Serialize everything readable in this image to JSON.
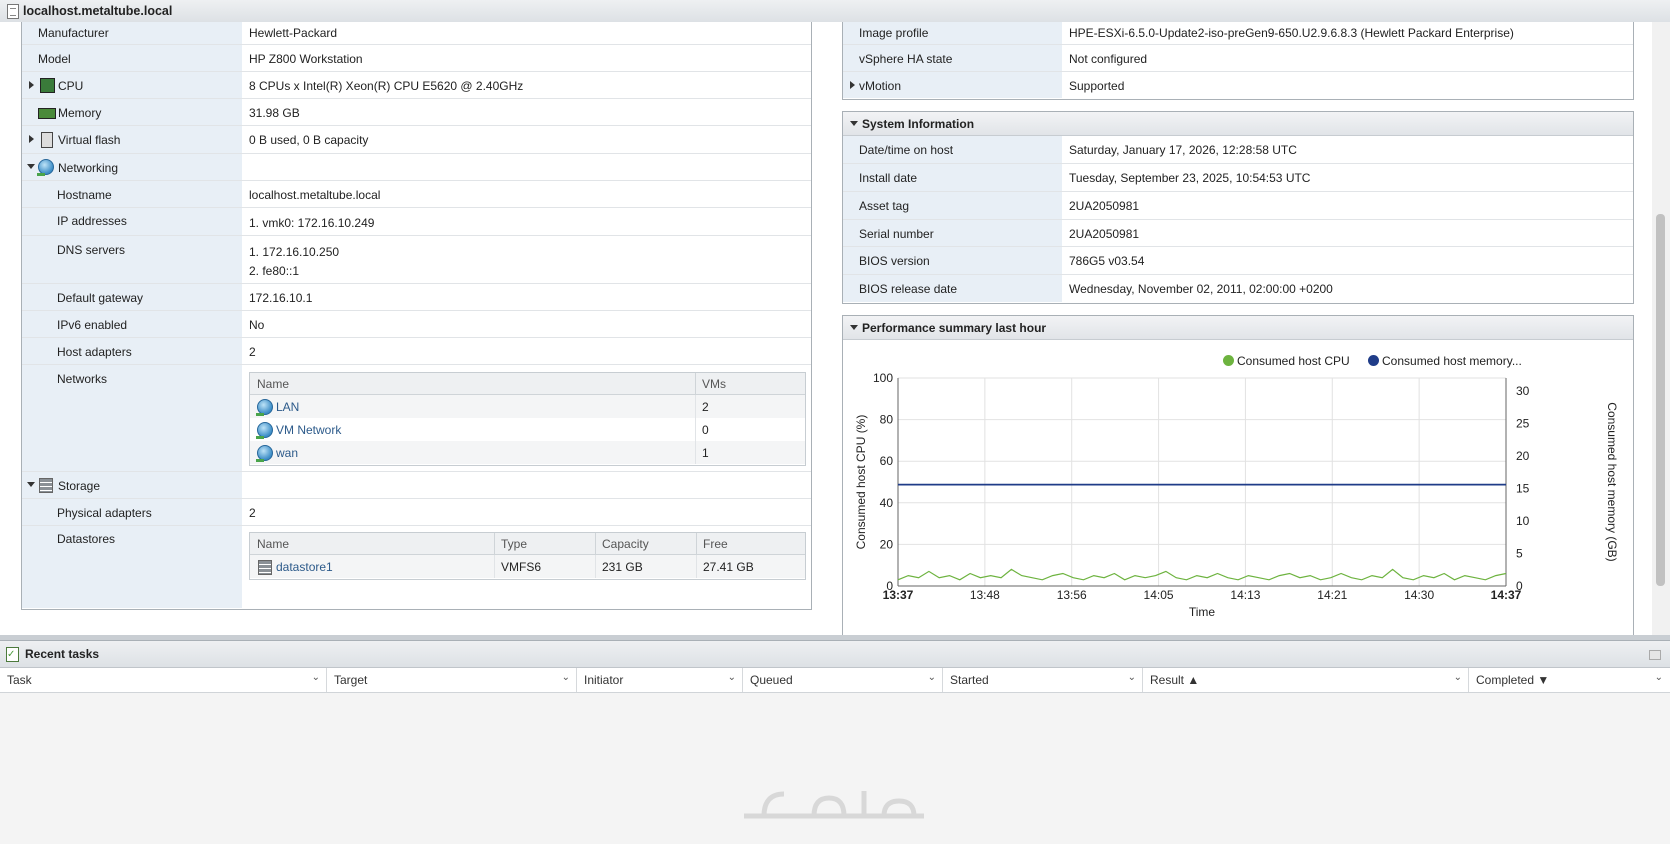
{
  "window": {
    "title": "localhost.metaltube.local"
  },
  "hardware": {
    "manufacturer": {
      "label": "Manufacturer",
      "value": "Hewlett-Packard"
    },
    "model": {
      "label": "Model",
      "value": "HP Z800 Workstation"
    },
    "cpu": {
      "label": "CPU",
      "value": "8 CPUs x Intel(R) Xeon(R) CPU E5620 @ 2.40GHz"
    },
    "memory": {
      "label": "Memory",
      "value": "31.98 GB"
    },
    "virtual_flash": {
      "label": "Virtual flash",
      "value": "0 B used, 0 B capacity"
    },
    "networking": {
      "label": "Networking",
      "hostname": {
        "label": "Hostname",
        "value": "localhost.metaltube.local"
      },
      "ip_addresses": {
        "label": "IP addresses",
        "value": "1. vmk0: 172.16.10.249"
      },
      "dns_servers": {
        "label": "DNS servers",
        "values": [
          "1. 172.16.10.250",
          "2. fe80::1"
        ]
      },
      "default_gateway": {
        "label": "Default gateway",
        "value": "172.16.10.1"
      },
      "ipv6_enabled": {
        "label": "IPv6 enabled",
        "value": "No"
      },
      "host_adapters": {
        "label": "Host adapters",
        "value": "2"
      },
      "networks": {
        "label": "Networks",
        "columns": [
          "Name",
          "VMs"
        ],
        "rows": [
          {
            "name": "LAN",
            "vms": "2"
          },
          {
            "name": "VM Network",
            "vms": "0"
          },
          {
            "name": "wan",
            "vms": "1"
          }
        ]
      }
    },
    "storage": {
      "label": "Storage",
      "physical_adapters": {
        "label": "Physical adapters",
        "value": "2"
      },
      "datastores": {
        "label": "Datastores",
        "columns": [
          "Name",
          "Type",
          "Capacity",
          "Free"
        ],
        "rows": [
          {
            "name": "datastore1",
            "type": "VMFS6",
            "capacity": "231 GB",
            "free": "27.41 GB"
          }
        ]
      }
    }
  },
  "config": {
    "image_profile": {
      "label": "Image profile",
      "value": "HPE-ESXi-6.5.0-Update2-iso-preGen9-650.U2.9.6.8.3 (Hewlett Packard Enterprise)"
    },
    "vsphere_ha": {
      "label": "vSphere HA state",
      "value": "Not configured"
    },
    "vmotion": {
      "label": "vMotion",
      "value": "Supported"
    }
  },
  "system_info": {
    "title": "System Information",
    "datetime": {
      "label": "Date/time on host",
      "value": "Saturday, January 17, 2026, 12:28:58 UTC"
    },
    "install_date": {
      "label": "Install date",
      "value": "Tuesday, September 23, 2025, 10:54:53 UTC"
    },
    "asset_tag": {
      "label": "Asset tag",
      "value": "2UA2050981"
    },
    "serial": {
      "label": "Serial number",
      "value": "2UA2050981"
    },
    "bios_version": {
      "label": "BIOS version",
      "value": "786G5 v03.54"
    },
    "bios_release": {
      "label": "BIOS release date",
      "value": "Wednesday, November 02, 2011, 02:00:00 +0200"
    }
  },
  "performance": {
    "title": "Performance summary last hour",
    "legend_cpu": "Consumed host CPU",
    "legend_mem": "Consumed host memory...",
    "y_left_label": "Consumed host CPU (%)",
    "y_right_label": "Consumed host memory (GB)",
    "x_label": "Time",
    "cpu_color": "#6db33f",
    "mem_color": "#1f3c88"
  },
  "chart_data": {
    "type": "line",
    "x_ticks": [
      "13:37",
      "13:48",
      "13:56",
      "14:05",
      "14:13",
      "14:21",
      "14:30",
      "14:37"
    ],
    "y_left_ticks": [
      "0",
      "20",
      "40",
      "60",
      "80",
      "100"
    ],
    "y_right_ticks": [
      "0",
      "5",
      "10",
      "15",
      "20",
      "25",
      "30"
    ],
    "y_left_range": [
      0,
      100
    ],
    "y_right_range": [
      0,
      32
    ],
    "series": [
      {
        "name": "Consumed host CPU",
        "axis": "left",
        "values": [
          3,
          5,
          4,
          7,
          4,
          5,
          3,
          6,
          4,
          5,
          4,
          8,
          5,
          4,
          3,
          5,
          6,
          4,
          3,
          5,
          4,
          6,
          3,
          5,
          4,
          5,
          7,
          4,
          3,
          5,
          4,
          6,
          4,
          3,
          5,
          4,
          3,
          5,
          6,
          4,
          5,
          3,
          4,
          6,
          4,
          3,
          5,
          4,
          8,
          4,
          3,
          5,
          4,
          6,
          3,
          5,
          4,
          3,
          5,
          6
        ]
      },
      {
        "name": "Consumed host memory...",
        "axis": "right",
        "values": [
          15.6,
          15.6,
          15.6,
          15.6,
          15.6,
          15.6,
          15.6,
          15.6,
          15.6,
          15.6
        ]
      }
    ],
    "grid": true,
    "legend": "top"
  },
  "tasks": {
    "title": "Recent tasks",
    "columns": [
      "Task",
      "Target",
      "Initiator",
      "Queued",
      "Started",
      "Result ▲",
      "Completed ▼"
    ]
  }
}
